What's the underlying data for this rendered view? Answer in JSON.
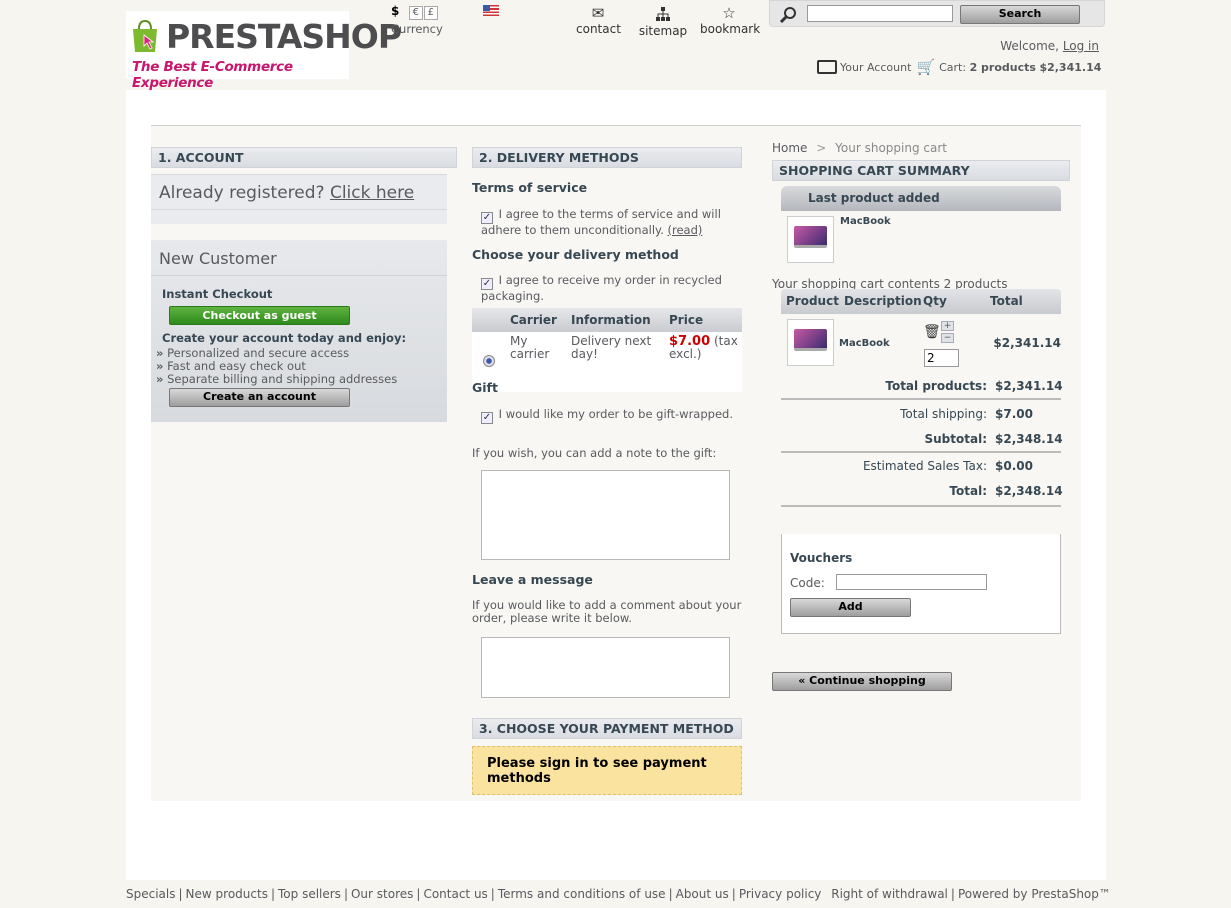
{
  "header": {
    "logo_name_a": "PRESTA",
    "logo_name_b": "SHOP",
    "logo_tagline": "The Best E-Commerce Experience",
    "currency_symbols": [
      "$",
      "€",
      "£"
    ],
    "currency_label": "Currency",
    "nav": [
      {
        "label": "contact",
        "icon": "envelope-icon"
      },
      {
        "label": "sitemap",
        "icon": "sitemap-icon"
      },
      {
        "label": "bookmark",
        "icon": "star-icon"
      }
    ],
    "search_placeholder": "",
    "search_button": "Search",
    "welcome": "Welcome,",
    "login": "Log in",
    "your_account": "Your Account",
    "cart_label": "Cart:",
    "cart_products": "2 products",
    "cart_total": "$2,341.14"
  },
  "account": {
    "heading": "1. ACCOUNT",
    "already_registered": "Already registered?",
    "click_here": "Click here",
    "new_customer": "New Customer",
    "instant_checkout": "Instant Checkout",
    "guest_button": "Checkout as guest",
    "create_intro": "Create your account today and enjoy:",
    "benefits": [
      "Personalized and secure access",
      "Fast and easy check out",
      "Separate billing and shipping addresses"
    ],
    "create_button": "Create an account"
  },
  "delivery": {
    "heading": "2. DELIVERY METHODS",
    "terms_title": "Terms of service",
    "terms_text": "I agree to the terms of service and will adhere to them unconditionally.",
    "terms_read": "(read)",
    "choose_title": "Choose your delivery method",
    "recycled_text": "I agree to receive my order in recycled packaging.",
    "carrier_headers": [
      "",
      "Carrier",
      "Information",
      "Price"
    ],
    "carrier": {
      "name": "My carrier",
      "info": "Delivery next day!",
      "price": "$7.00",
      "tax": "(tax excl.)"
    },
    "gift_title": "Gift",
    "gift_text": "I would like my order to be gift-wrapped.",
    "gift_note": "If you wish, you can add a note to the gift:",
    "message_title": "Leave a message",
    "message_text": "If you would like to add a comment about your order, please write it below."
  },
  "payment": {
    "heading": "3. CHOOSE YOUR PAYMENT METHOD",
    "notice": "Please sign in to see payment methods"
  },
  "cart": {
    "breadcrumb_home": "Home",
    "breadcrumb_sep": ">",
    "breadcrumb_current": "Your shopping cart",
    "summary_heading": "SHOPPING CART SUMMARY",
    "last_added_title": "Last product added",
    "last_added_name": "MacBook",
    "contents_text": "Your shopping cart contents 2 products",
    "table_headers": [
      "Product",
      "Description",
      "Qty",
      "Total"
    ],
    "item": {
      "name": "MacBook",
      "qty": "2",
      "total": "$2,341.14"
    },
    "totals": [
      {
        "label": "Total products:",
        "value": "$2,341.14"
      },
      {
        "label": "Total shipping:",
        "value": "$7.00"
      },
      {
        "label": "Subtotal:",
        "value": "$2,348.14"
      },
      {
        "label": "Estimated Sales Tax:",
        "value": "$0.00"
      },
      {
        "label": "Total:",
        "value": "$2,348.14"
      }
    ],
    "vouchers_title": "Vouchers",
    "code_label": "Code:",
    "add_button": "Add",
    "continue_button": "« Continue shopping"
  },
  "footer": {
    "links": [
      "Specials",
      "New products",
      "Top sellers",
      "Our stores",
      "Contact us",
      "Terms and conditions of use",
      "About us",
      "Privacy policy",
      "Right of withdrawal",
      "Powered by PrestaShop™"
    ]
  }
}
